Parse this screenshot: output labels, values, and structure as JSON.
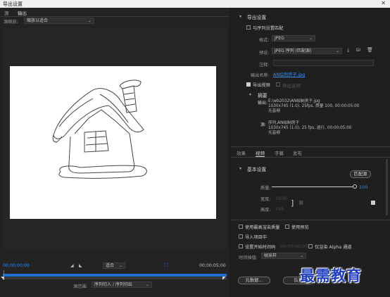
{
  "window": {
    "title": "导出设置",
    "close_glyph": "✕"
  },
  "left_tabs": [
    "源",
    "输出"
  ],
  "source_scaling": {
    "label": "源缩放:",
    "value": "缩放以适合"
  },
  "timeline": {
    "start_tc": "00;00;00;00",
    "fit_value": "适合",
    "end_tc": "00;00;05;00",
    "source_range_label": "源范围:",
    "source_range_value": "序列切入 / 序列切出"
  },
  "export_settings": {
    "title": "导出设置",
    "match_sequence": "与序列设置匹配",
    "format_label": "格式:",
    "format_value": "JPEG",
    "preset_label": "预设:",
    "preset_value": "JPEG 序列 (匹配源)",
    "comment_label": "注释:",
    "output_name_label": "输出名称:",
    "output_name_value": "AN绘制房子.jpg",
    "export_video": "导出视频",
    "export_audio": "导出音频"
  },
  "summary": {
    "title": "摘要",
    "output_label": "输出:",
    "output_lines": [
      "E:\\wb2032\\AN绘制房子.jpg",
      "1030x745 (1.0), 25fps, 质量 100, 00:00:05:00",
      "无音频"
    ],
    "source_label": "源:",
    "source_lines": [
      "序列,AN绘制房子",
      "1030x745 (1.0), 25 fps, 逐行, 00:00:05:00",
      "无音频"
    ]
  },
  "right_tabs": [
    "效果",
    "视频",
    "字幕",
    "发布"
  ],
  "basic_settings": {
    "title": "基本设置",
    "match_source_button": "匹配源",
    "quality_label": "质量:",
    "quality_value": "100",
    "quality_fraction": 1.0,
    "width_label": "宽度:",
    "width_value": "1030",
    "height_label": "高度:",
    "height_value": "745"
  },
  "bottom_options": {
    "max_render": "使用最高渲染质量",
    "use_preview": "使用预览",
    "import_project": "导入项目中",
    "set_start_tc": "设置开始时间码",
    "start_tc_value": "00:00:00:00",
    "render_alpha": "仅渲染 Alpha 通道",
    "interp_label": "时间插值:",
    "interp_value": "帧采样"
  },
  "buttons": {
    "metadata": "元数据...",
    "queue": "队列"
  },
  "watermark_text": "最需教育",
  "colors": {
    "accent_blue": "#2d8ceb",
    "watermark_blue": "#1f3fc0"
  }
}
